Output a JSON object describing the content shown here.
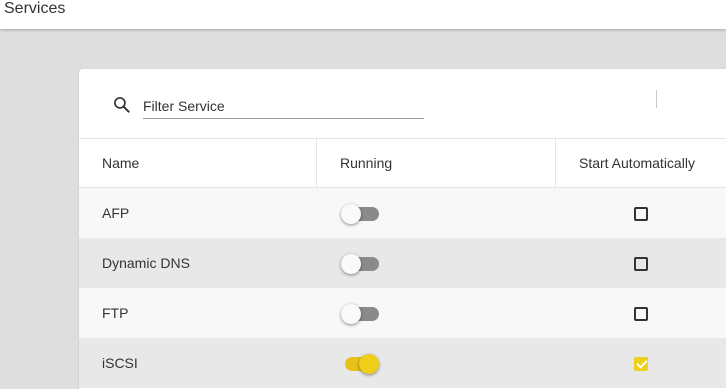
{
  "header": {
    "title": "Services"
  },
  "search": {
    "placeholder": "Filter Service",
    "value": ""
  },
  "table": {
    "columns": {
      "name": "Name",
      "running": "Running",
      "start_automatically": "Start Automatically"
    },
    "rows": [
      {
        "name": "AFP",
        "running": false,
        "start_automatically": false
      },
      {
        "name": "Dynamic DNS",
        "running": false,
        "start_automatically": false
      },
      {
        "name": "FTP",
        "running": false,
        "start_automatically": false
      },
      {
        "name": "iSCSI",
        "running": true,
        "start_automatically": true
      }
    ]
  },
  "colors": {
    "accent": "#f0cf1a",
    "toggle_off_track": "#8a8a8a",
    "background": "#dedede"
  },
  "icons": {
    "search": "search-icon"
  }
}
